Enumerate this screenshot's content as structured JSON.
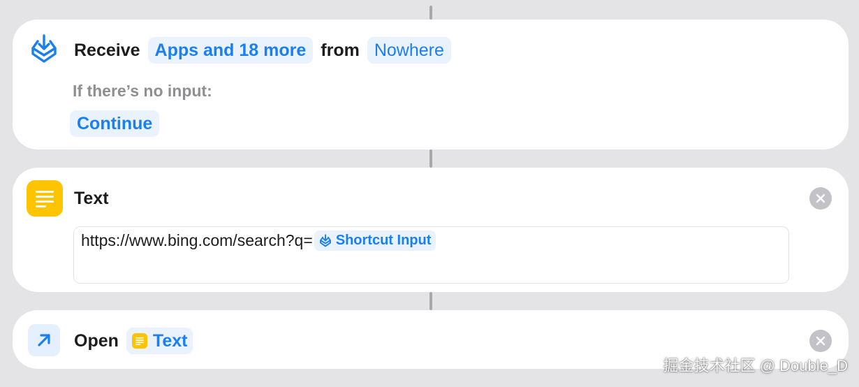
{
  "receive_action": {
    "verb": "Receive",
    "types_token": "Apps and 18 more",
    "from_word": "from",
    "source_token": "Nowhere",
    "no_input_label": "If there’s no input:",
    "no_input_token": "Continue",
    "icon": "download-tray-icon"
  },
  "text_action": {
    "title": "Text",
    "url_text": "https://www.bing.com/search?q=",
    "variable_token": "Shortcut Input",
    "icon": "text-lines-icon",
    "icon_color": "#ffc400"
  },
  "open_action": {
    "verb": "Open",
    "token": "Text",
    "icon": "arrow-up-right-icon"
  },
  "watermark": "掘金技术社区 @ Double_D",
  "colors": {
    "accent": "#1a7ff0",
    "token_background": "#eaf3fd",
    "background": "#e4e4e6"
  }
}
